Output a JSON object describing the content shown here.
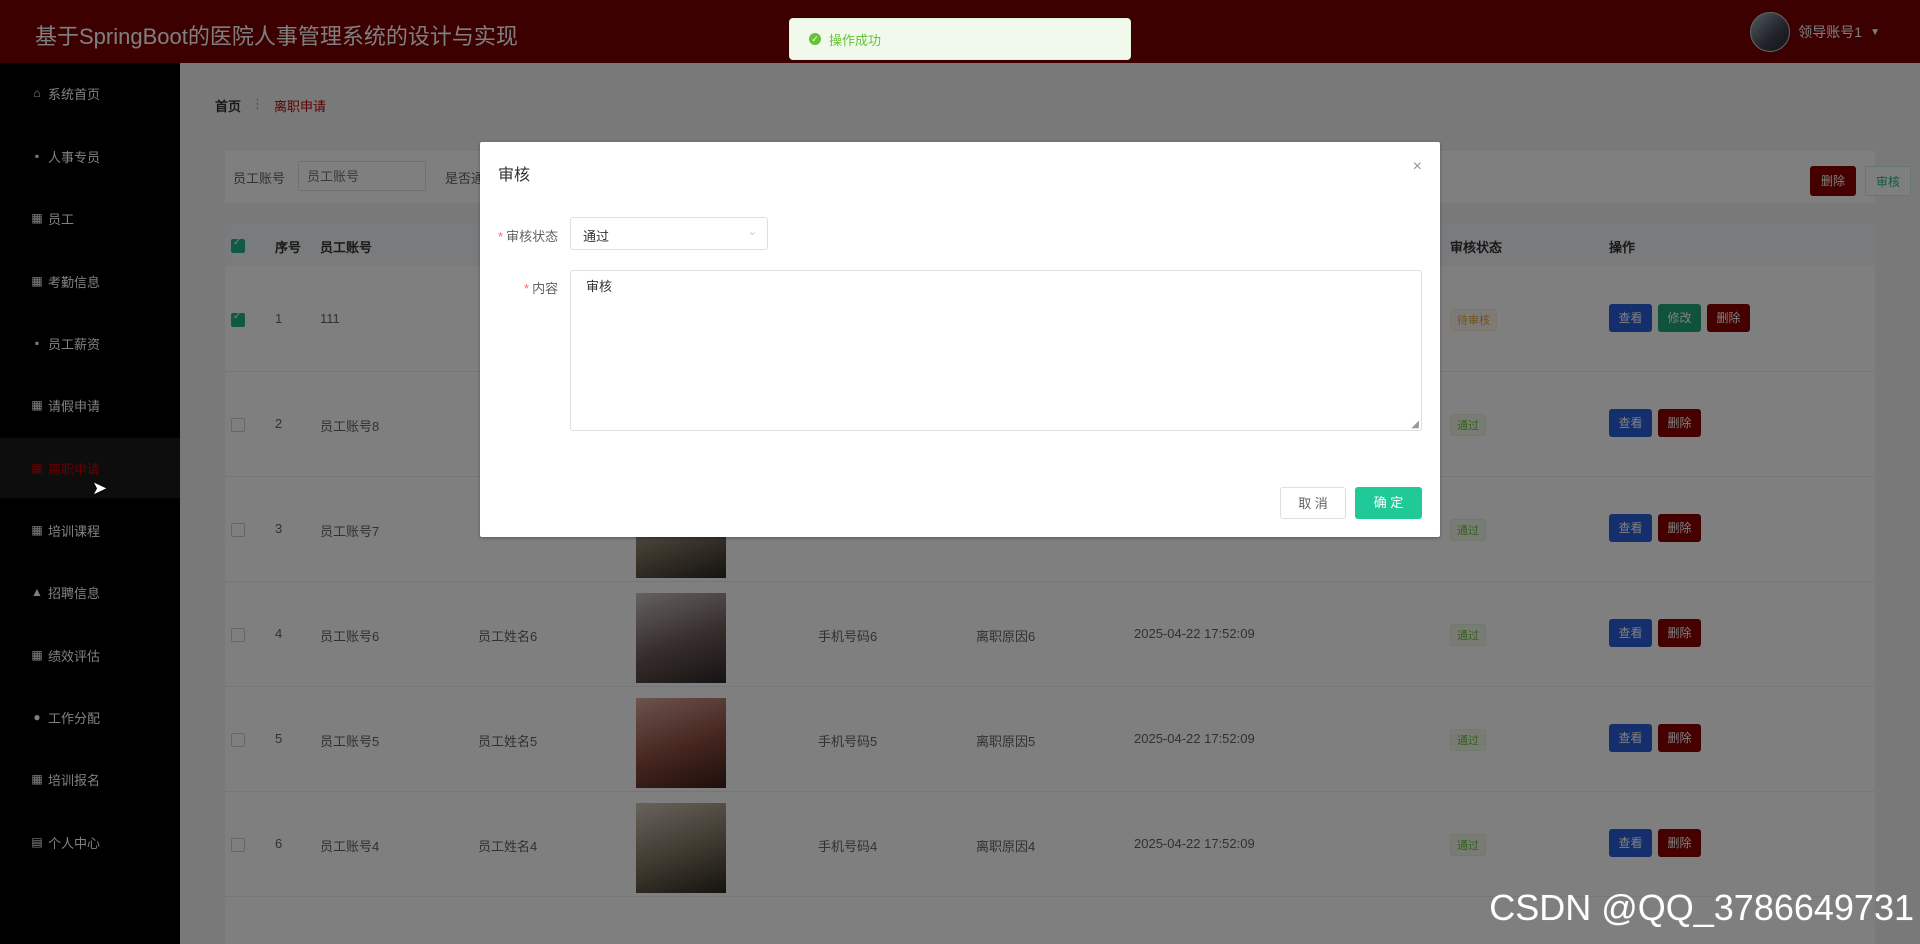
{
  "app": {
    "title": "基于SpringBoot的医院人事管理系统的设计与实现",
    "user": "领导账号1",
    "caret": "▼"
  },
  "toast": {
    "message": "操作成功",
    "icon": "✓"
  },
  "sidebar": {
    "items": [
      {
        "label": "系统首页",
        "icon": "⌂",
        "icon_name": "home-icon"
      },
      {
        "label": "人事专员",
        "icon": "▪",
        "icon_name": "chat-icon"
      },
      {
        "label": "员工",
        "icon": "▦",
        "icon_name": "grid-icon"
      },
      {
        "label": "考勤信息",
        "icon": "▦",
        "icon_name": "grid-icon"
      },
      {
        "label": "员工薪资",
        "icon": "▪",
        "icon_name": "chat-icon"
      },
      {
        "label": "请假申请",
        "icon": "▦",
        "icon_name": "grid-icon"
      },
      {
        "label": "离职申请",
        "icon": "▦",
        "icon_name": "grid-icon",
        "active": true
      },
      {
        "label": "培训课程",
        "icon": "▦",
        "icon_name": "grid-icon"
      },
      {
        "label": "招聘信息",
        "icon": "▲",
        "icon_name": "thumb-icon"
      },
      {
        "label": "绩效评估",
        "icon": "▦",
        "icon_name": "grid-icon"
      },
      {
        "label": "工作分配",
        "icon": "●",
        "icon_name": "pin-icon"
      },
      {
        "label": "培训报名",
        "icon": "▦",
        "icon_name": "grid-icon"
      },
      {
        "label": "个人中心",
        "icon": "▤",
        "icon_name": "card-icon"
      }
    ]
  },
  "breadcrumb": {
    "home": "首页",
    "sep": "⋮",
    "current": "离职申请"
  },
  "search": {
    "label1": "员工账号",
    "placeholder1": "员工账号",
    "label2": "是否通",
    "delete_label": "删除",
    "audit_label": "审核"
  },
  "table": {
    "headers": {
      "index": "序号",
      "account": "员工账号",
      "status": "审核状态",
      "ops": "操作"
    },
    "rows": [
      {
        "index": "1",
        "account": "111",
        "name": "",
        "phone": "",
        "reason": "",
        "time": "",
        "status": "待审核",
        "checked": true,
        "editable": true
      },
      {
        "index": "2",
        "account": "员工账号8",
        "name": "",
        "phone": "",
        "reason": "",
        "time": "",
        "status": "通过"
      },
      {
        "index": "3",
        "account": "员工账号7",
        "name": "",
        "phone": "",
        "reason": "",
        "time": "",
        "status": "通过"
      },
      {
        "index": "4",
        "account": "员工账号6",
        "name": "员工姓名6",
        "phone": "手机号码6",
        "reason": "离职原因6",
        "time": "2025-04-22 17:52:09",
        "status": "通过"
      },
      {
        "index": "5",
        "account": "员工账号5",
        "name": "员工姓名5",
        "phone": "手机号码5",
        "reason": "离职原因5",
        "time": "2025-04-22 17:52:09",
        "status": "通过"
      },
      {
        "index": "6",
        "account": "员工账号4",
        "name": "员工姓名4",
        "phone": "手机号码4",
        "reason": "离职原因4",
        "time": "2025-04-22 17:52:09",
        "status": "通过"
      }
    ],
    "btn_view": "查看",
    "btn_edit": "修改",
    "btn_delete": "删除"
  },
  "dialog": {
    "title": "审核",
    "close": "×",
    "status_label": "审核状态",
    "status_value": "通过",
    "content_label": "内容",
    "content_value": "审核",
    "cancel": "取 消",
    "confirm": "确 定"
  },
  "watermark": "CSDN @QQ_3786649731",
  "colors": {
    "topbar": "#7a0000",
    "sidebar": "#000000",
    "accent": "#20c997",
    "danger": "#8b0000",
    "primary": "#2b5fd9"
  }
}
